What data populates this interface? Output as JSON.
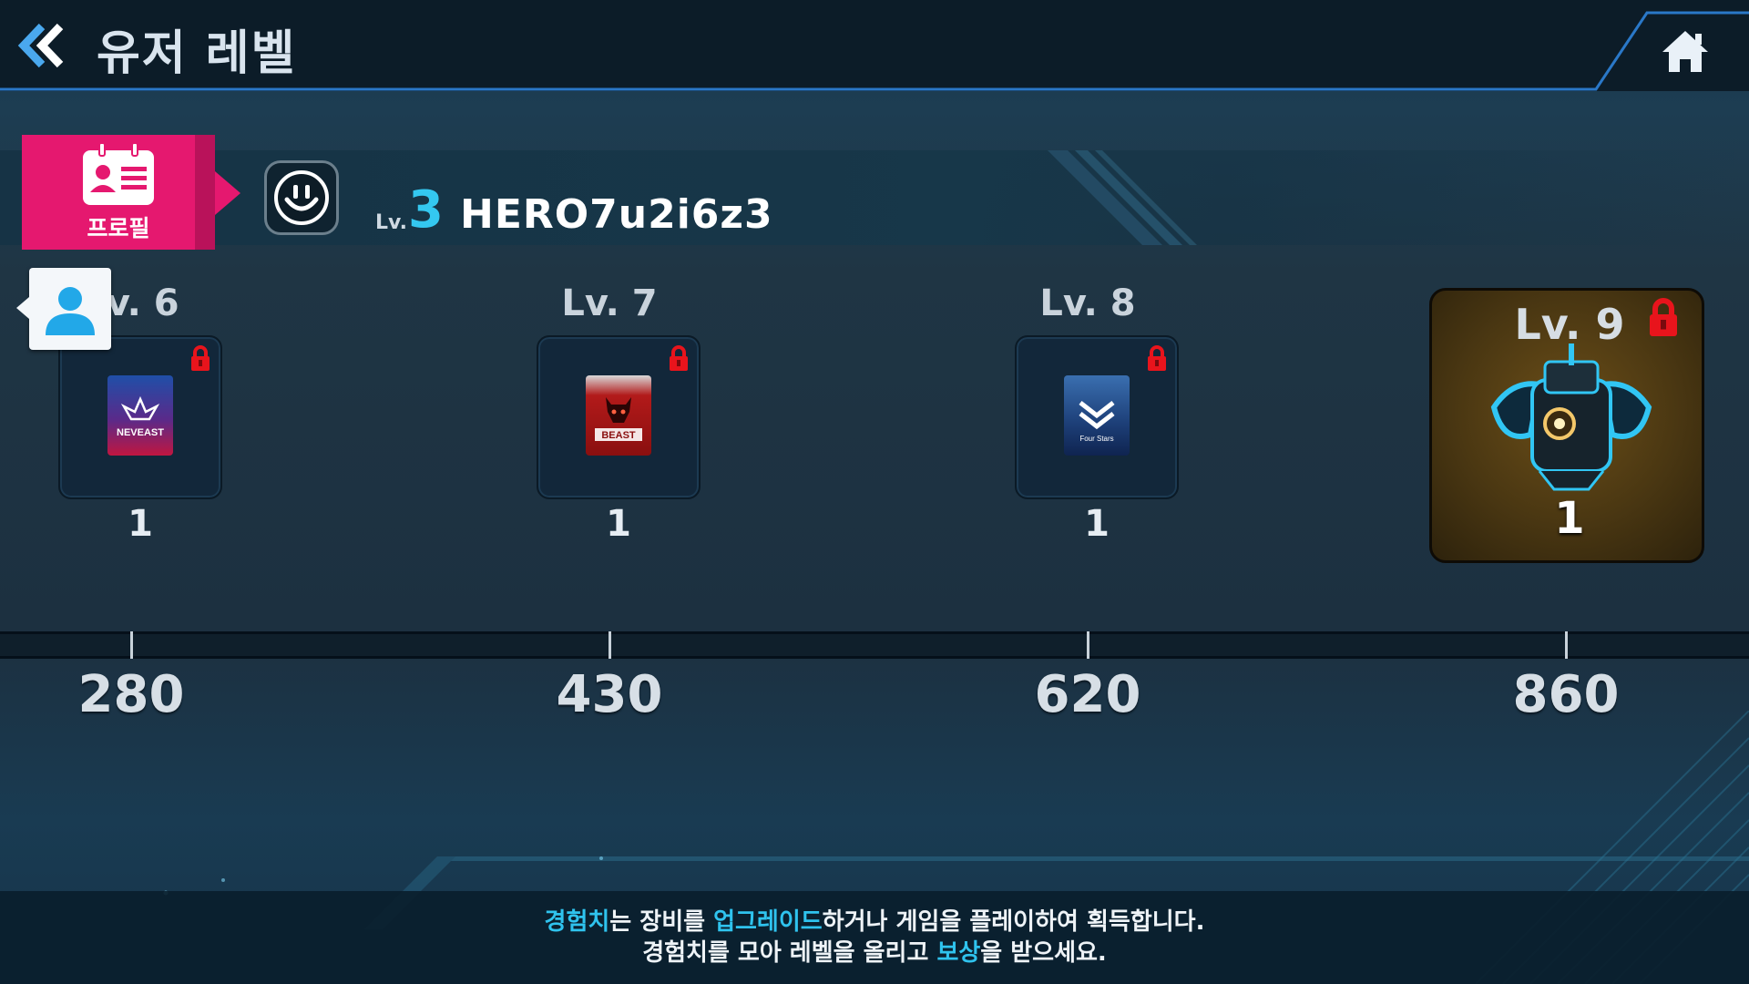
{
  "header": {
    "title": "유저 레벨",
    "back_icon": "double-chevron-left-icon",
    "home_icon": "home-icon"
  },
  "profile": {
    "tab_label": "프로필",
    "tab_icon": "id-card-icon",
    "emblem_icon": "smiley-emblem-icon",
    "level_prefix": "Lv.",
    "level": "3",
    "name": "HERO7u2i6z3"
  },
  "avatar_icon": "user-avatar-icon",
  "rewards": [
    {
      "level_label": "Lv. 6",
      "quantity": "1",
      "pack_name": "NEVEAST",
      "locked": true
    },
    {
      "level_label": "Lv. 7",
      "quantity": "1",
      "pack_name": "BEAST",
      "locked": true
    },
    {
      "level_label": "Lv. 8",
      "quantity": "1",
      "pack_name": "Four Stars",
      "locked": true
    },
    {
      "level_label": "Lv. 9",
      "quantity": "1",
      "locked": true
    }
  ],
  "exp_thresholds": [
    "280",
    "430",
    "620",
    "860"
  ],
  "info": {
    "line1_part1": "경험치",
    "line1_part2": "는 장비를 ",
    "line1_part3": "업그레이드",
    "line1_part4": "하거나 게임을 플레이하여 획득합니다.",
    "line2_part1": "경험치를 모아 레벨을 올리고 ",
    "line2_part2": "보상",
    "line2_part3": "을 받으세요."
  },
  "colors": {
    "accent_cyan": "#2fc3ee",
    "profile_pink": "#e5186f",
    "lock_red": "#e8141c",
    "premium_gold": "#4a3712"
  }
}
